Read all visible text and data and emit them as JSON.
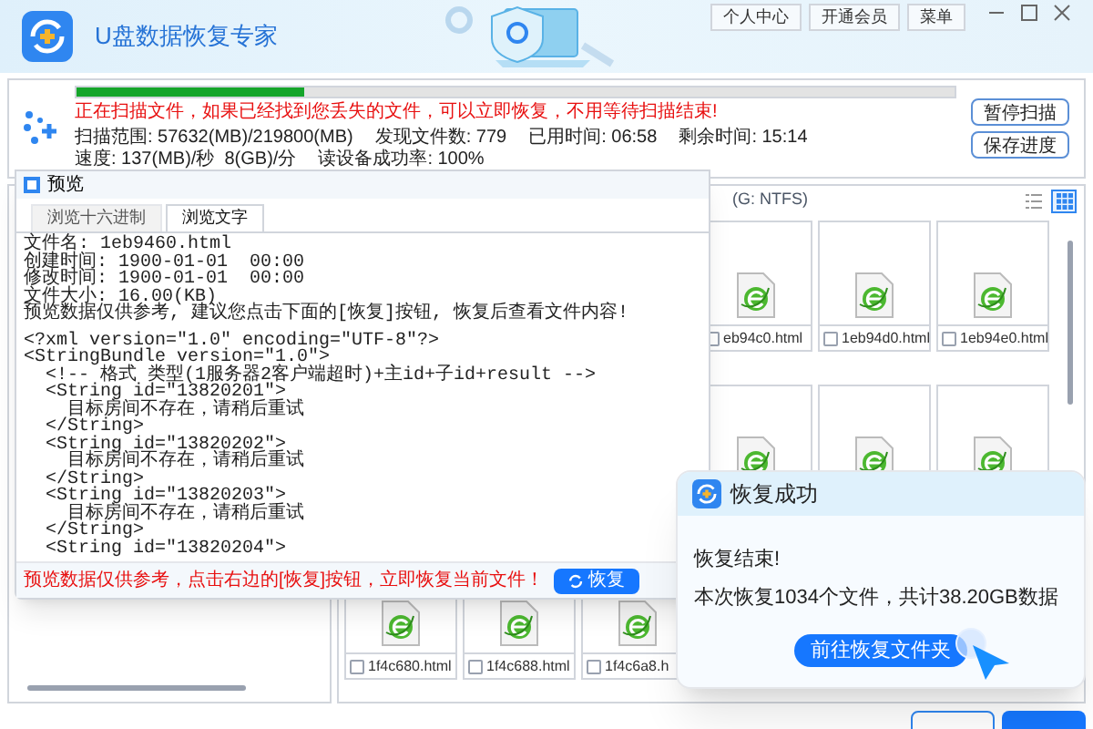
{
  "window": {
    "title": "U盘数据恢复专家",
    "header_buttons": [
      "个人中心",
      "开通会员",
      "菜单"
    ]
  },
  "scan": {
    "level": 0.26,
    "message": "正在扫描文件，如果已经找到您丢失的文件，可以立即恢复，不用等待扫描结束!",
    "stats": [
      "扫描范围: 57632(MB)/219800(MB)",
      "发现文件数: 779",
      "已用时间: 06:58",
      "剩余时间: 15:14",
      "速度: 137(MB)/秒  8(GB)/分",
      "读设备成功率: 100%"
    ],
    "buttons": [
      "暂停扫描",
      "保存进度"
    ]
  },
  "file_panel": {
    "title": "(G: NTFS)",
    "views": [
      {
        "kind": "list",
        "selected": false
      },
      {
        "kind": "grid",
        "selected": true
      }
    ],
    "files": [
      {
        "kind": "html",
        "name": "eb94c0.html",
        "checked": false
      },
      {
        "kind": "html",
        "name": "1eb94d0.html",
        "checked": false
      },
      {
        "kind": "html",
        "name": "1eb94e0.html",
        "checked": false
      },
      {
        "kind": "html"
      },
      {
        "kind": "html"
      },
      {
        "kind": "html"
      },
      {
        "kind": "html",
        "name": "1f4c680.html",
        "checked": false
      },
      {
        "kind": "html",
        "name": "1f4c688.html",
        "checked": false
      },
      {
        "kind": "html",
        "name": "1f4c6a8.h",
        "checked": false
      }
    ]
  },
  "preview": {
    "title": "预览",
    "tabs": [
      {
        "label": "浏览十六进制",
        "selected": false
      },
      {
        "label": "浏览文字",
        "selected": true
      }
    ],
    "info_lines": [
      "文件名: 1eb9460.html",
      "创建时间: 1900-01-01  00:00",
      "修改时间: 1900-01-01  00:00",
      "文件大小: 16.00(KB)",
      "预览数据仅供参考, 建议您点击下面的[恢复]按钮, 恢复后查看文件内容!"
    ],
    "code_lines": [
      "<?xml version=\"1.0\" encoding=\"UTF-8\"?>",
      "<StringBundle version=\"1.0\">",
      "  <!-- 格式 类型(1服务器2客户端超时)+主id+子id+result -->",
      "  <String id=\"13820201\">",
      "    目标房间不存在，请稍后重试",
      "  </String>",
      "  <String id=\"13820202\">",
      "    目标房间不存在，请稍后重试",
      "  </String>",
      "  <String id=\"13820203\">",
      "    目标房间不存在，请稍后重试",
      "  </String>",
      "  <String id=\"13820204\">"
    ],
    "notice": "预览数据仅供参考，点击右边的[恢复]按钮，立即恢复当前文件！",
    "button": "恢复"
  },
  "toast": {
    "title": "恢复成功",
    "lines": [
      "恢复结束!",
      "本次恢复1034个文件，共计38.20GB数据"
    ],
    "button": "前往恢复文件夹"
  }
}
